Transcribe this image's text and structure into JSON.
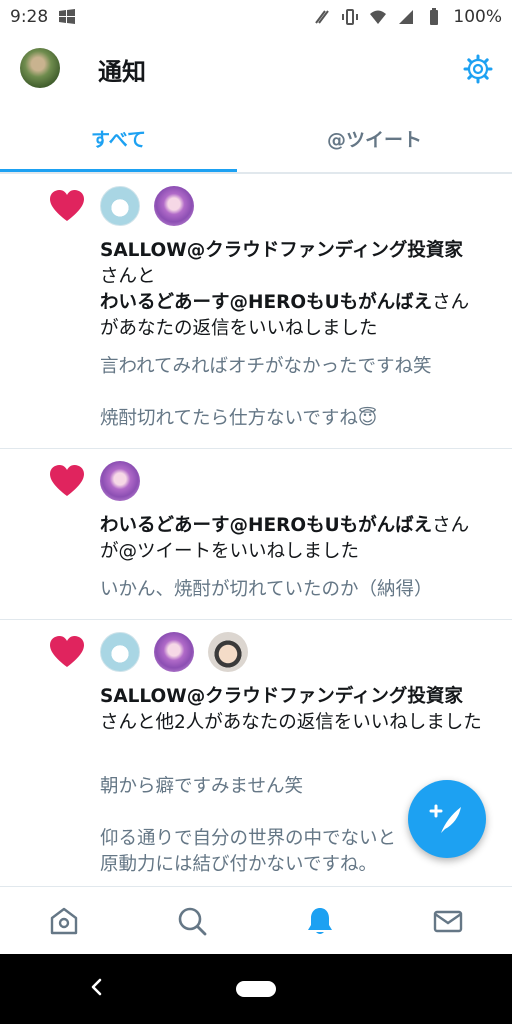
{
  "status_bar": {
    "time": "9:28",
    "battery": "100%"
  },
  "header": {
    "title": "通知"
  },
  "tabs": [
    {
      "label": "すべて",
      "active": true
    },
    {
      "label": "@ツイート",
      "active": false
    }
  ],
  "notifications": [
    {
      "avatars": [
        "rabbit",
        "anime"
      ],
      "name1": "SALLOW@クラウドファンディング投資家",
      "connector": "さんと",
      "name2": "わいるどあーす@HEROもUもがんばえ",
      "suffix": "さん",
      "action": "があなたの返信をいいねしました",
      "quote_line1": "言われてみればオチがなかったですね笑",
      "quote_line2": "焼酎切れてたら仕方ないですね😇"
    },
    {
      "avatars": [
        "anime"
      ],
      "name1": "わいるどあーす@HEROもUもがんばえ",
      "suffix": "さん",
      "action": "が@ツイートをいいねしました",
      "quote_line1": "いかん、焼酎が切れていたのか（納得）"
    },
    {
      "avatars": [
        "rabbit",
        "anime",
        "baby"
      ],
      "name1": "SALLOW@クラウドファンディング投資家",
      "action": "さんと他2人があなたの返信をいいねしました",
      "quote_line1": "朝から癖ですみません笑",
      "quote_line2": "仰る通りで自分の世界の中でないと",
      "quote_line3": "原動力には結び付かないですね。"
    }
  ],
  "colors": {
    "accent": "#1da1f2",
    "heart": "#e0245e",
    "secondary_text": "#657786"
  },
  "icons": {
    "settings": "gear-icon",
    "compose": "compose-tweet-icon",
    "home": "home-icon",
    "search": "search-icon",
    "notifications": "bell-icon",
    "messages": "mail-icon"
  }
}
